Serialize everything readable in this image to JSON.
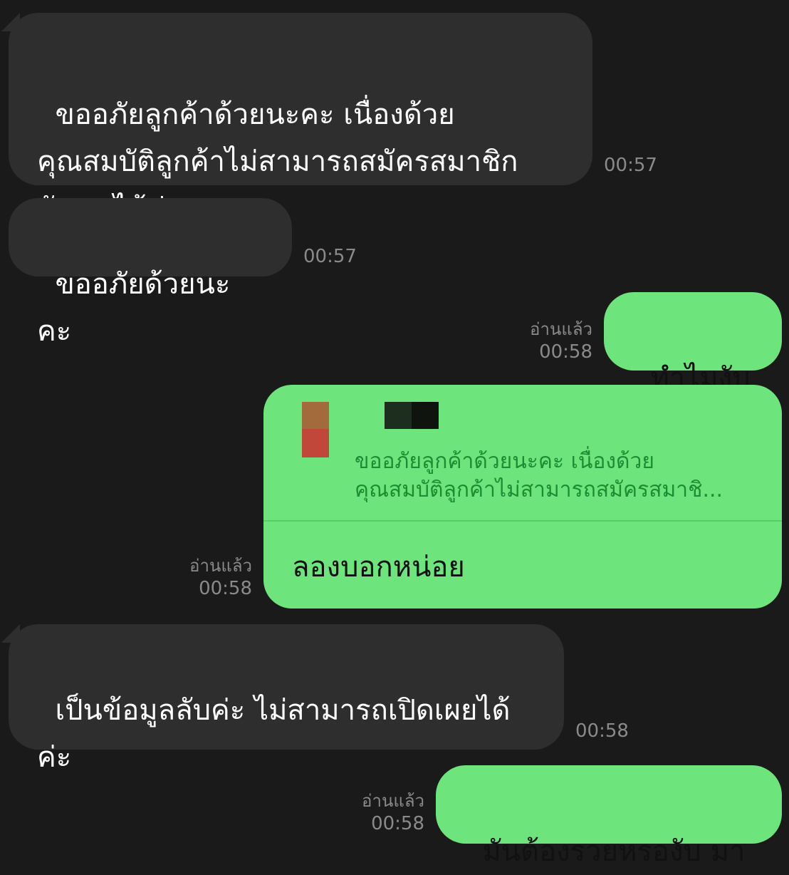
{
  "messages": [
    {
      "direction": "incoming",
      "text": "ขออภัยลูกค้าด้วยนะคะ เนื่องด้วย\nคุณสมบัติลูกค้าไม่สามารถสมัครสมาชิก\nกับเราได้ค่ะ",
      "time": "00:57"
    },
    {
      "direction": "incoming",
      "text": "ขออภัยด้วยนะคะ",
      "time": "00:57"
    },
    {
      "direction": "outgoing",
      "text": "ทำไมงับ",
      "read": "อ่านแล้ว",
      "time": "00:58"
    },
    {
      "direction": "outgoing",
      "quoted_text": "ขออภัยลูกค้าด้วยนะคะ เนื่องด้วย\nคุณสมบัติลูกค้าไม่สามารถสมัครสมาชิ...",
      "text": "ลองบอกหน่อย",
      "read": "อ่านแล้ว",
      "time": "00:58"
    },
    {
      "direction": "incoming",
      "text": "เป็นข้อมูลลับค่ะ ไม่สามารถเปิดเผยได้\nค่ะ",
      "time": "00:58"
    },
    {
      "direction": "outgoing",
      "text": "มันต้องรวยหรองับ มา",
      "read": "อ่านแล้ว",
      "time": "00:58"
    }
  ],
  "colors": {
    "background": "#1a1a1a",
    "incoming_bubble": "#2e2e2e",
    "outgoing_bubble": "#6ee57c",
    "meta_text": "#8a8a8a"
  }
}
